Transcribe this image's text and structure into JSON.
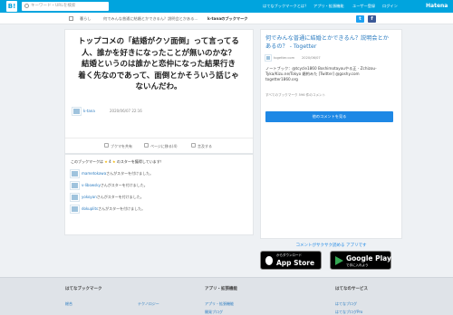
{
  "header": {
    "logo": "B!",
    "search_placeholder": "キーワード・URLを検索",
    "nav": [
      "はてなブックマークとは？",
      "アプリ・拡張機能",
      "ユーザー登録",
      "ログイン"
    ],
    "brand": "Hatena"
  },
  "breadcrumb": {
    "items": [
      "暮らし",
      "何でみんな普通に結婚とかできるん？説明会とかある…",
      "k-tanaのブックマーク"
    ]
  },
  "bookmark": {
    "comment": "トップコメの「結婚がクソ面倒」って言ってる人、誰かを好きになったことが無いのかな？ 結婚というのは誰かと恋仲になった結果行き着く先なのであって、面倒とかそういう話じゃないんだわ。",
    "user": "k-tana",
    "date": "2020/06/07 22:16",
    "actions": [
      "ブクマを共有",
      "ページに移る(4)",
      "言及する"
    ]
  },
  "stars": {
    "header_prefix": "この",
    "header_middle": "ブックマークは",
    "header_suffix": "のスターを獲得しています！",
    "count": "4",
    "star_symbol": "★",
    "entries": [
      {
        "user": "mametokawa",
        "text": "さんがスターを付けました。"
      },
      {
        "user": "v-libowsky",
        "text": "さんがスターを付けました。"
      },
      {
        "user": "yokoyan",
        "text": "さんがスターを付けました。"
      },
      {
        "user": "dokuplits",
        "text": "さんがスターを付けました。"
      }
    ]
  },
  "entry": {
    "title": "何でみんな普通に結婚とかできるん？説明会とかあるの？ - Togetter",
    "site": "togetter.com",
    "date": "2020/06/07",
    "description": "ノートブック：@tcycle1860 Boshimotayouやる正 - Zchizou-Tyka/Kizu.ne/Tokyo 婚約みた [Twitter] @goshy.com togetter1860.org",
    "stats": "すべてのブックマーク 596 件のコメント",
    "button": "他のコメントを見る"
  },
  "promo": {
    "text": "コメントがサクサク読める アプリです",
    "app_store_big": "App Store",
    "app_store_small": "からダウンロード",
    "google_big": "Google Play",
    "google_small": "で手に入れよう"
  },
  "footer": {
    "col1_head": "はてなブックマーク",
    "col1_links": [
      "総合",
      "テクノロジー"
    ],
    "col2_head": "アプリ・拡張機能",
    "col2_links": [
      "アプリ・拡張機能",
      "開発ブログ"
    ],
    "col3_head": "はてなのサービス",
    "col3_links": [
      "はてなブログ",
      "はてなブログPro"
    ]
  },
  "colors": {
    "brand": "#00a4de",
    "button": "#1e88e5",
    "star": "#f3b500",
    "twitter": "#1da1f2",
    "facebook": "#3b5998"
  },
  "icons": [
    "search-icon",
    "home-icon",
    "twitter-icon",
    "facebook-icon",
    "share-icon",
    "page-icon",
    "quote-icon",
    "star-icon",
    "apple-icon",
    "play-icon"
  ]
}
